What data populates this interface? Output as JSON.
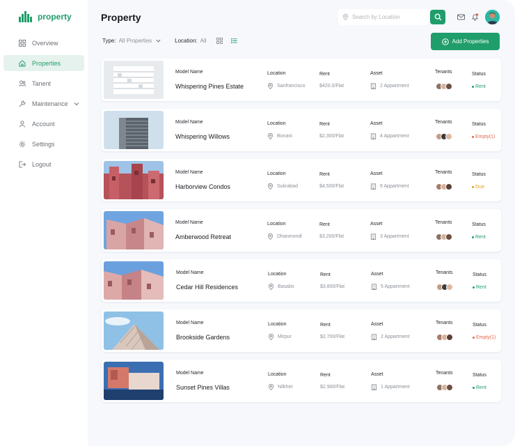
{
  "brand": {
    "name": "property"
  },
  "sidebar": {
    "items": [
      {
        "label": "Overview",
        "icon": "grid-icon"
      },
      {
        "label": "Properties",
        "icon": "home-icon",
        "active": true
      },
      {
        "label": "Tanent",
        "icon": "users-icon"
      },
      {
        "label": "Maintenance",
        "icon": "wrench-icon",
        "has_chevron": true
      },
      {
        "label": "Account",
        "icon": "user-icon"
      },
      {
        "label": "Settings",
        "icon": "gear-icon"
      },
      {
        "label": "Logout",
        "icon": "logout-icon"
      }
    ]
  },
  "header": {
    "title": "Property",
    "search_placeholder": "Search by Location"
  },
  "filters": {
    "type_label": "Type:",
    "type_value": "All Properties",
    "location_label": "Location:",
    "location_value": "All"
  },
  "add_button": {
    "label": "Add Properties"
  },
  "columns": {
    "model": "Model Name",
    "location": "Location",
    "rent": "Rent",
    "asset": "Asset",
    "tenants": "Tenants",
    "status": "Status"
  },
  "properties": [
    {
      "name": "Whispering Pines Estate",
      "location": "Sanfrancisco",
      "rent": "$420.0/Flat",
      "asset": "2 Appartment",
      "status": "Rent",
      "status_kind": "rent"
    },
    {
      "name": "Whispering Willows",
      "location": "Bonani",
      "rent": "$2,300/Flat",
      "asset": "4 Appartment",
      "status": "Empty(1)",
      "status_kind": "empty"
    },
    {
      "name": "Harborview Condos",
      "location": "Sukrabad",
      "rent": "$4,500/Flat",
      "asset": "6 Appartment",
      "status": "Due",
      "status_kind": "due"
    },
    {
      "name": "Amberwood Retreat",
      "location": "Dhanmondi",
      "rent": "$3,200/Flat",
      "asset": "3 Appartment",
      "status": "Rent",
      "status_kind": "rent"
    },
    {
      "name": "Cedar Hill Residences",
      "location": "Basabo",
      "rent": "$3,800/Flat",
      "asset": "5 Appartment",
      "status": "Rent",
      "status_kind": "rent"
    },
    {
      "name": "Brookside Gardens",
      "location": "Mirpur",
      "rent": "$2,700/Flat",
      "asset": "2 Appartment",
      "status": "Empty(1)",
      "status_kind": "empty"
    },
    {
      "name": "Sunset Pines Villas",
      "location": "Nilkhet",
      "rent": "$2,900/Flat",
      "asset": "1 Appartment",
      "status": "Rent",
      "status_kind": "rent"
    }
  ],
  "colors": {
    "accent": "#1f9d6a",
    "rent": "#1f9d6a",
    "empty": "#e0664d",
    "due": "#e2a21b"
  }
}
